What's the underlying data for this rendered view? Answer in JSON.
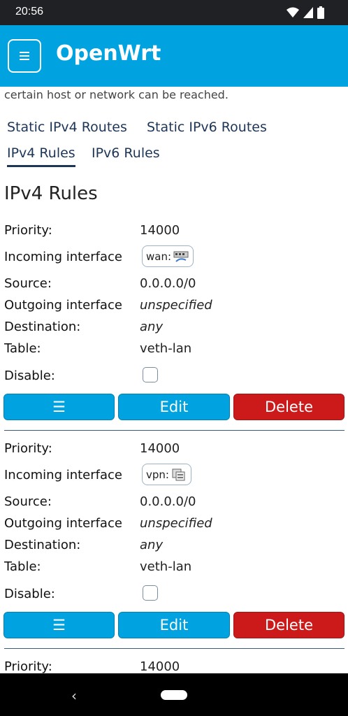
{
  "status": {
    "time": "20:56"
  },
  "app": {
    "title": "OpenWrt",
    "menu_icon": "hamburger-icon"
  },
  "page": {
    "description": "certain host or network can be reached.",
    "tabs": [
      {
        "label": "Static IPv4 Routes"
      },
      {
        "label": "Static IPv6 Routes"
      },
      {
        "label": "IPv4 Rules"
      },
      {
        "label": "IPv6 Rules"
      }
    ],
    "active_tab": "IPv4 Rules",
    "section_title": "IPv4 Rules"
  },
  "labels": {
    "priority": "Priority:",
    "incoming": "Incoming interface",
    "source": "Source:",
    "outgoing": "Outgoing interface",
    "destination": "Destination:",
    "table": "Table:",
    "disable": "Disable:"
  },
  "buttons": {
    "sort_icon": "☰",
    "edit": "Edit",
    "delete": "Delete"
  },
  "rules": [
    {
      "priority": "14000",
      "incoming": "wan:",
      "incoming_icon": "ethernet-port-icon",
      "source": "0.0.0.0/0",
      "outgoing": "unspecified",
      "destination": "any",
      "table": "veth-lan",
      "disabled": false
    },
    {
      "priority": "14000",
      "incoming": "vpn:",
      "incoming_icon": "tunnel-interface-icon",
      "source": "0.0.0.0/0",
      "outgoing": "unspecified",
      "destination": "any",
      "table": "veth-lan",
      "disabled": false
    },
    {
      "priority": "14000"
    }
  ],
  "colors": {
    "accent": "#00a3e0",
    "danger": "#cc1a1a",
    "tab_text": "#1d3557"
  }
}
